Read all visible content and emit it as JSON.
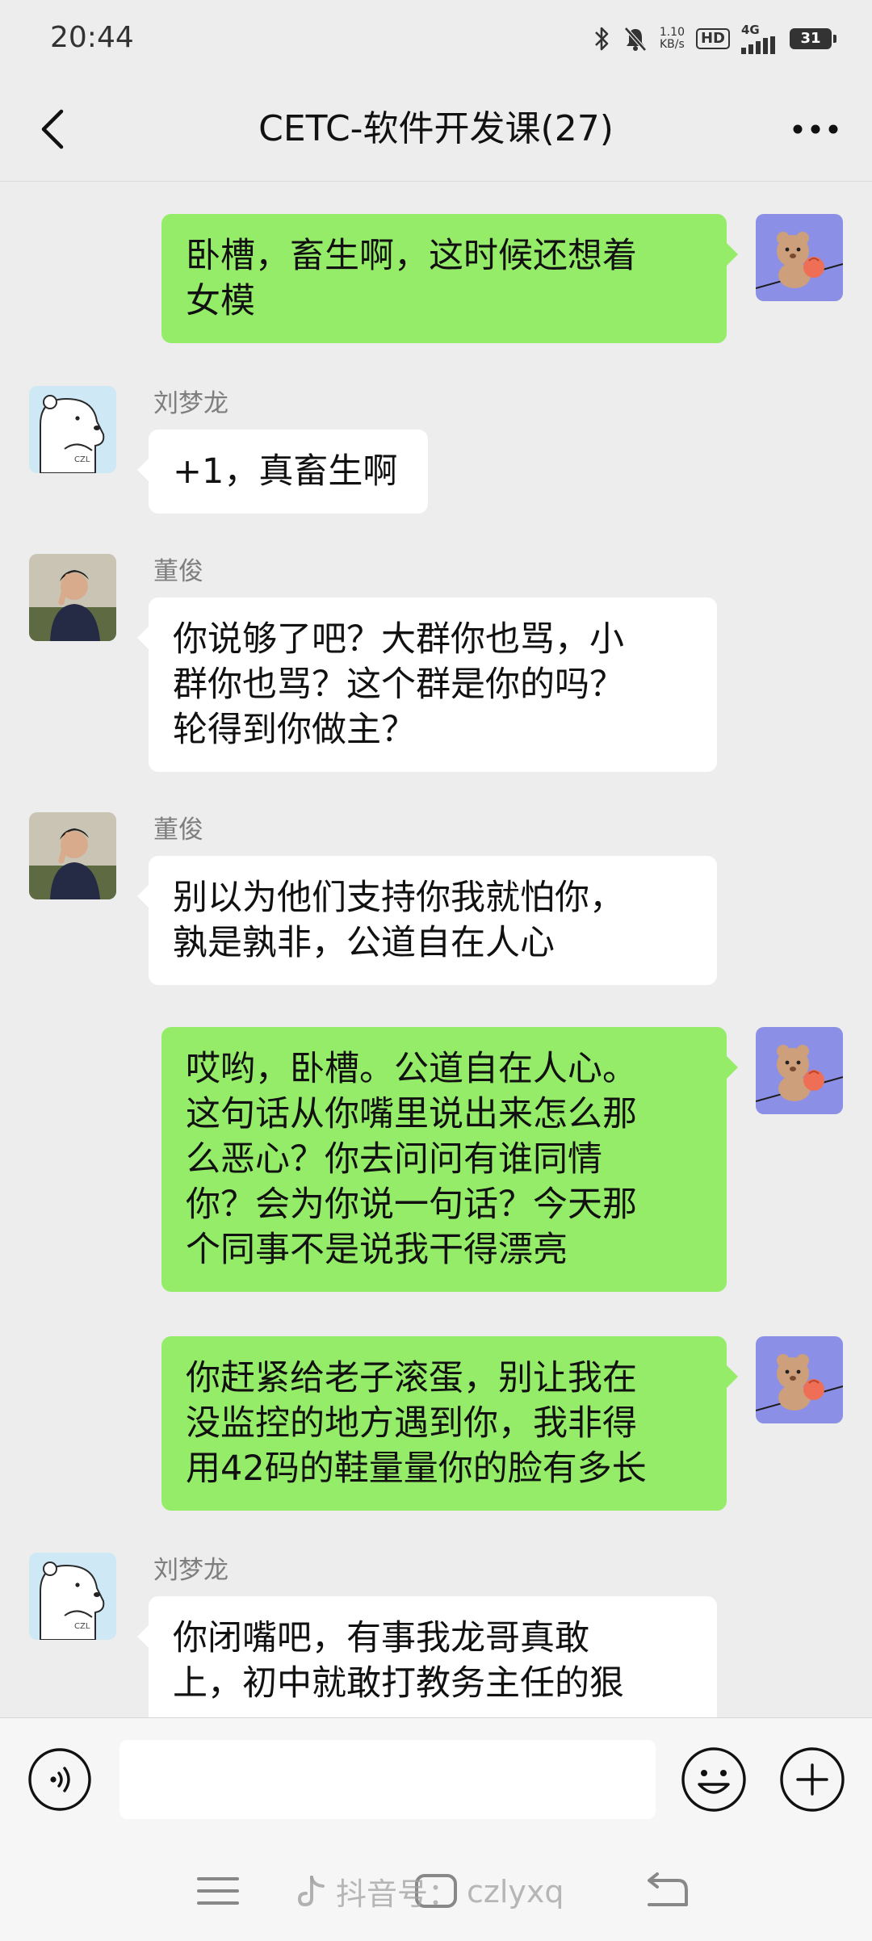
{
  "status_bar": {
    "time": "20:44",
    "net_speed_value": "1.10",
    "net_speed_unit": "KB/s",
    "hd_label": "HD",
    "network_label": "4G",
    "battery_level": "31"
  },
  "nav": {
    "title": "CETC-软件开发课(27)"
  },
  "messages": [
    {
      "side": "right",
      "sender": "",
      "text": "卧槽，畜生啊，这时候还想着\n女模"
    },
    {
      "side": "left",
      "sender": "刘梦龙",
      "text": "+1，真畜生啊"
    },
    {
      "side": "left",
      "sender": "董俊",
      "text": "你说够了吧？大群你也骂，小\n群你也骂？这个群是你的吗？\n轮得到你做主？"
    },
    {
      "side": "left",
      "sender": "董俊",
      "text": "别以为他们支持你我就怕你，\n孰是孰非，公道自在人心"
    },
    {
      "side": "right",
      "sender": "",
      "text": "哎哟，卧槽。公道自在人心。\n这句话从你嘴里说出来怎么那\n么恶心？你去问问有谁同情\n你？会为你说一句话？今天那\n个同事不是说我干得漂亮"
    },
    {
      "side": "right",
      "sender": "",
      "text": "你赶紧给老子滚蛋，别让我在\n没监控的地方遇到你，我非得\n用42码的鞋量量你的脸有多长"
    },
    {
      "side": "left",
      "sender": "刘梦龙",
      "text": "你闭嘴吧，有事我龙哥真敢\n上，初中就敢打教务主任的狠"
    }
  ],
  "input": {
    "value": "",
    "placeholder": ""
  },
  "watermark": {
    "app": "抖音号：",
    "handle": "czlyxq"
  },
  "colors": {
    "background": "#ededed",
    "self_bubble": "#95ec69",
    "other_bubble": "#ffffff"
  },
  "icons": {
    "back": "chevron-left-icon",
    "more": "more-dots-icon",
    "voice": "voice-icon",
    "emoji": "emoji-icon",
    "plus": "plus-icon"
  }
}
